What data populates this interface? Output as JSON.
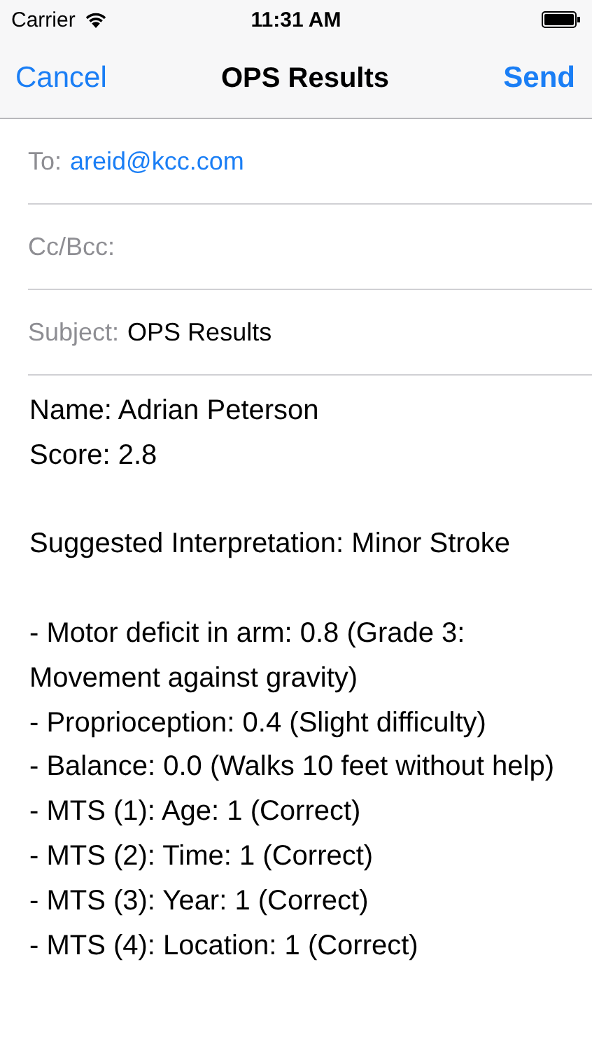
{
  "status_bar": {
    "carrier": "Carrier",
    "time": "11:31 AM"
  },
  "nav_bar": {
    "left_button": "Cancel",
    "title": "OPS Results",
    "right_button": "Send"
  },
  "fields": [
    {
      "label": "To:",
      "value": "areid@kcc.com",
      "kind": "address"
    },
    {
      "label": "Cc/Bcc:",
      "kind": "empty"
    },
    {
      "label": "Subject:",
      "value": "OPS Results",
      "kind": "text"
    }
  ],
  "body": [
    [
      "Name: Adrian Peterson",
      "Score: 2.8"
    ],
    [
      "Suggested Interpretation: Minor Stroke"
    ],
    [
      "- Motor deficit in arm: 0.8 (Grade 3: Movement against gravity)",
      "- Proprioception: 0.4 (Slight difficulty)",
      "- Balance: 0.0 (Walks 10 feet without help)",
      "- MTS (1): Age: 1 (Correct)",
      "- MTS (2): Time: 1 (Correct)",
      "- MTS (3): Year: 1 (Correct)",
      "- MTS (4): Location: 1 (Correct)"
    ]
  ]
}
